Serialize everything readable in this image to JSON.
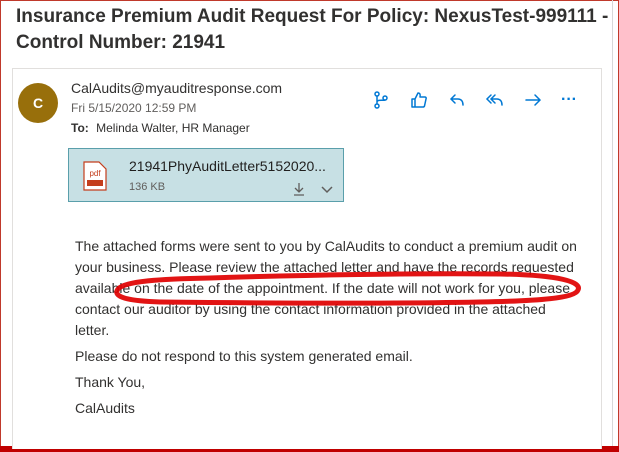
{
  "email": {
    "subject": "Insurance Premium Audit Request For Policy: NexusTest-999111 - Control Number: 21941",
    "avatar_initial": "C",
    "sender": "CalAudits@myauditresponse.com",
    "date": "Fri 5/15/2020 12:59 PM",
    "to_label": "To:",
    "to_value": "Melinda Walter, HR Manager"
  },
  "toolbar": {
    "icons": [
      "branch-icon",
      "like-icon",
      "reply-icon",
      "reply-all-icon",
      "forward-icon",
      "more-icon"
    ],
    "more_label": "···"
  },
  "attachment": {
    "icon": "pdf-icon",
    "icon_label": "pdf",
    "filename": "21941PhyAuditLetter5152020...",
    "size": "136 KB"
  },
  "body": {
    "paragraph_1": "The attached forms were sent to you by CalAudits to conduct a premium audit on your business. Please review the attached letter and have the records requested available on the date of the appointment. If the date will not work for you, please contact our auditor by using the contact information provided in the attached letter.",
    "paragraph_2": "Please do not respond to this system generated email.",
    "closing": "Thank You,",
    "signature": "CalAudits"
  },
  "colors": {
    "avatar": "#986f0b",
    "accent": "#0078d4",
    "attachment_bg": "#c7e0e4",
    "annotation": "#e00000"
  }
}
